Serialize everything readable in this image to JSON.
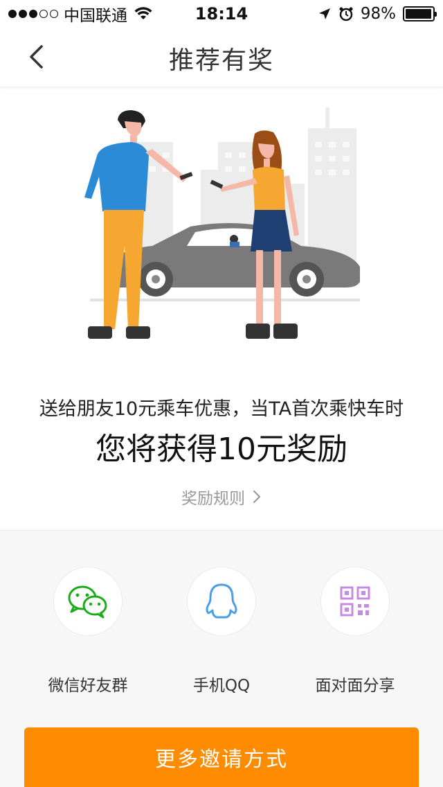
{
  "status_bar": {
    "carrier": "中国联通",
    "time": "18:14",
    "battery": "98%",
    "battery_level": 0.98
  },
  "nav": {
    "title": "推荐有奖"
  },
  "promo": {
    "subtitle": "送给朋友10元乘车优惠，当TA首次乘快车时",
    "headline": "您将获得10元奖励",
    "rules_link": "奖励规则"
  },
  "share": {
    "items": [
      {
        "label": "微信好友群",
        "icon": "wechat-icon",
        "color": "#1aad19"
      },
      {
        "label": "手机QQ",
        "icon": "qq-icon",
        "color": "#4a9ee8"
      },
      {
        "label": "面对面分享",
        "icon": "qr-code-icon",
        "color": "#c58be0"
      }
    ]
  },
  "actions": {
    "more_invites": "更多邀请方式"
  },
  "colors": {
    "accent": "#ff8c00"
  }
}
